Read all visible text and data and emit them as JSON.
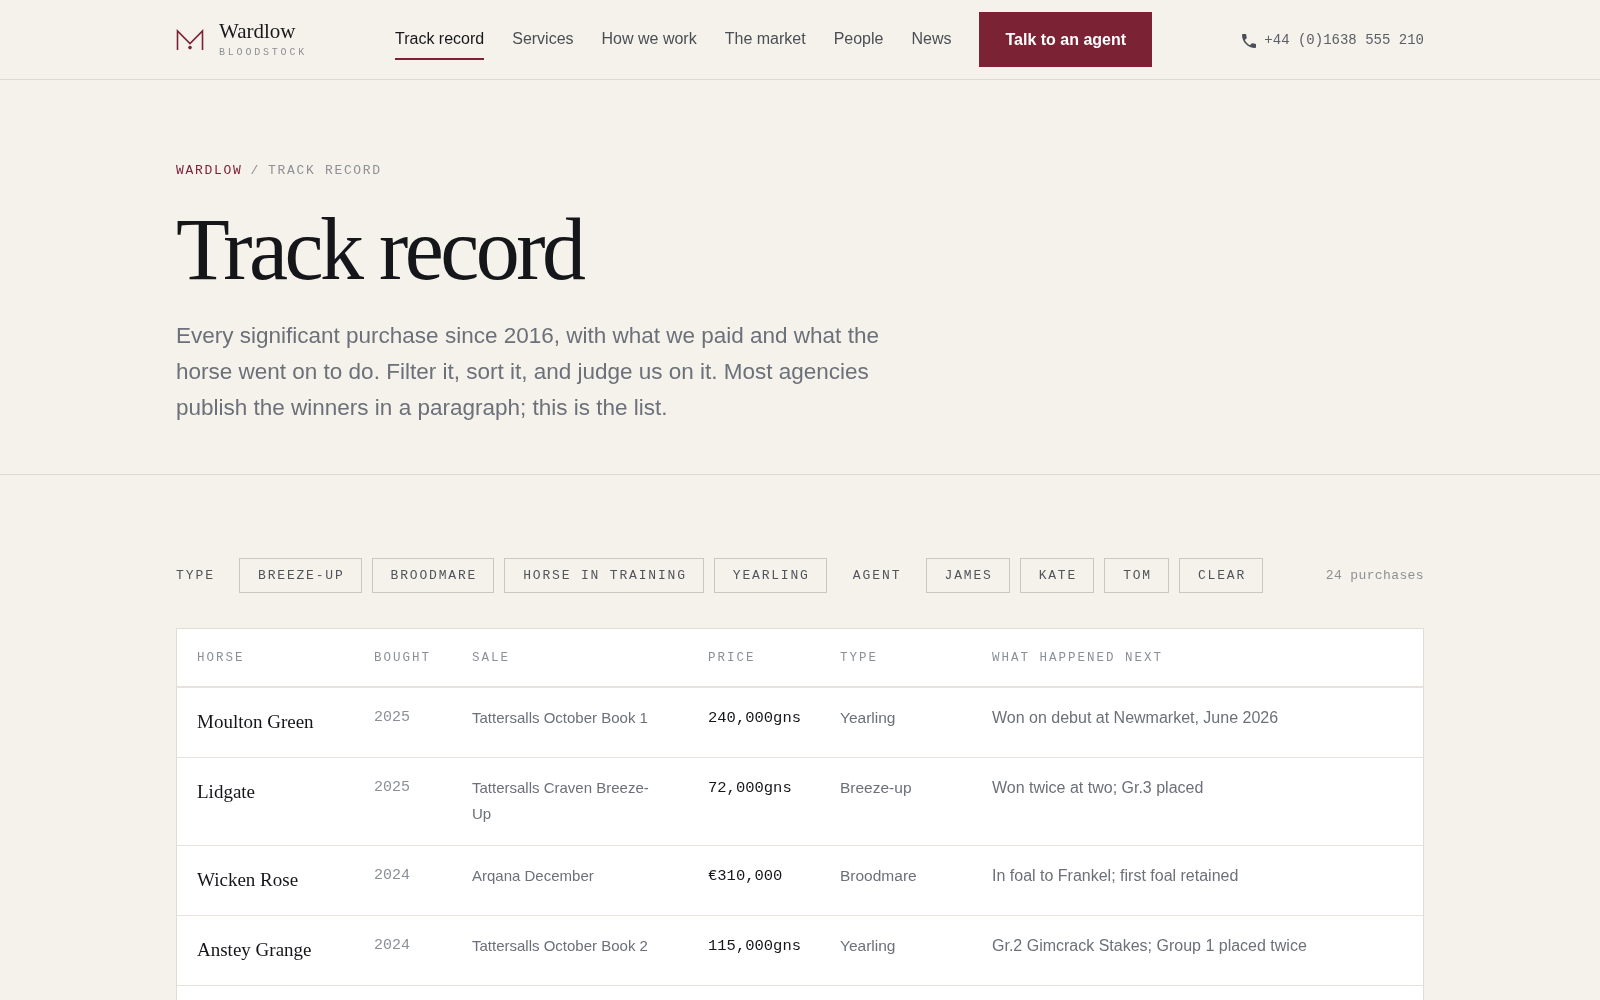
{
  "header": {
    "brand": {
      "name": "Wardlow",
      "tagline": "BLOODSTOCK"
    },
    "nav": [
      {
        "label": "Track record",
        "selected": true
      },
      {
        "label": "Services",
        "selected": false
      },
      {
        "label": "How we work",
        "selected": false
      },
      {
        "label": "The market",
        "selected": false
      },
      {
        "label": "People",
        "selected": false
      },
      {
        "label": "News",
        "selected": false
      }
    ],
    "cta_button": "Talk to an agent",
    "phone": "+44 (0)1638 555 210"
  },
  "hero": {
    "breadcrumb": {
      "home": "WARDLOW",
      "separator": "/",
      "current": "TRACK RECORD"
    },
    "title": "Track record",
    "intro": "Every significant purchase since 2016, with what we paid and what the horse went on to do. Filter it, sort it, and judge us on it. Most agencies publish the winners in a paragraph; this is the list."
  },
  "filters": {
    "groups": [
      {
        "label": "TYPE",
        "options": [
          {
            "label": "BREEZE-UP",
            "selected": false
          },
          {
            "label": "BROODMARE",
            "selected": false
          },
          {
            "label": "HORSE IN TRAINING",
            "selected": false
          },
          {
            "label": "YEARLING",
            "selected": false
          }
        ]
      },
      {
        "label": "AGENT",
        "options": [
          {
            "label": "JAMES",
            "selected": false
          },
          {
            "label": "KATE",
            "selected": false
          },
          {
            "label": "TOM",
            "selected": false
          }
        ]
      }
    ],
    "clear_button": "CLEAR",
    "result_count": "24 purchases"
  },
  "table": {
    "columns": [
      "HORSE",
      "BOUGHT",
      "SALE",
      "PRICE",
      "TYPE",
      "WHAT HAPPENED NEXT"
    ],
    "rows": [
      {
        "horse": "Moulton Green",
        "bought": "2025",
        "sale": "Tattersalls October Book 1",
        "price": "240,000gns",
        "type": "Yearling",
        "next": "Won on debut at Newmarket, June 2026"
      },
      {
        "horse": "Lidgate",
        "bought": "2025",
        "sale": "Tattersalls Craven Breeze-Up",
        "price": "72,000gns",
        "type": "Breeze-up",
        "next": "Won twice at two; Gr.3 placed"
      },
      {
        "horse": "Wicken Rose",
        "bought": "2024",
        "sale": "Arqana December",
        "price": "€310,000",
        "type": "Broodmare",
        "next": "In foal to Frankel; first foal retained"
      },
      {
        "horse": "Anstey Grange",
        "bought": "2024",
        "sale": "Tattersalls October Book 2",
        "price": "115,000gns",
        "type": "Yearling",
        "next": "Gr.2 Gimcrack Stakes; Group 1 placed twice"
      }
    ]
  }
}
